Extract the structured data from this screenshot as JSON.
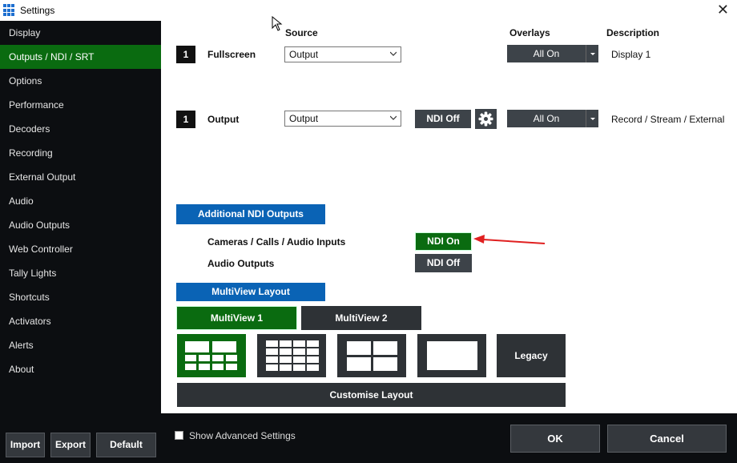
{
  "window": {
    "title": "Settings",
    "close_glyph": "✕"
  },
  "sidebar": {
    "items": [
      {
        "label": "Display",
        "active": false
      },
      {
        "label": "Outputs / NDI / SRT",
        "active": true
      },
      {
        "label": "Options",
        "active": false
      },
      {
        "label": "Performance",
        "active": false
      },
      {
        "label": "Decoders",
        "active": false
      },
      {
        "label": "Recording",
        "active": false
      },
      {
        "label": "External Output",
        "active": false
      },
      {
        "label": "Audio",
        "active": false
      },
      {
        "label": "Audio Outputs",
        "active": false
      },
      {
        "label": "Web Controller",
        "active": false
      },
      {
        "label": "Tally Lights",
        "active": false
      },
      {
        "label": "Shortcuts",
        "active": false
      },
      {
        "label": "Activators",
        "active": false
      },
      {
        "label": "Alerts",
        "active": false
      },
      {
        "label": "About",
        "active": false
      }
    ],
    "buttons": {
      "import": "Import",
      "export": "Export",
      "default": "Default"
    }
  },
  "headers": {
    "source": "Source",
    "overlays": "Overlays",
    "description": "Description"
  },
  "outputs": [
    {
      "number": "1",
      "label": "Fullscreen",
      "source": "Output",
      "overlays": "All On",
      "description": "Display 1"
    },
    {
      "number": "1",
      "label": "Output",
      "source": "Output",
      "ndi": "NDI Off",
      "overlays": "All On",
      "description": "Record / Stream / External"
    }
  ],
  "additional_ndi": {
    "header": "Additional NDI Outputs",
    "rows": [
      {
        "label": "Cameras / Calls / Audio Inputs",
        "state": "NDI On",
        "on": true
      },
      {
        "label": "Audio Outputs",
        "state": "NDI Off",
        "on": false
      }
    ]
  },
  "multiview": {
    "header": "MultiView Layout",
    "tabs": [
      {
        "label": "MultiView 1",
        "active": true
      },
      {
        "label": "MultiView 2",
        "active": false
      }
    ],
    "legacy_label": "Legacy",
    "customise_label": "Customise Layout"
  },
  "footer": {
    "show_advanced": "Show Advanced Settings",
    "ok": "OK",
    "cancel": "Cancel"
  },
  "colors": {
    "accent_green": "#0a6b10",
    "accent_blue": "#0a63b5",
    "sidebar_bg": "#0c0e11",
    "button_dark": "#3d4349",
    "annotation_arrow": "#e02020"
  }
}
